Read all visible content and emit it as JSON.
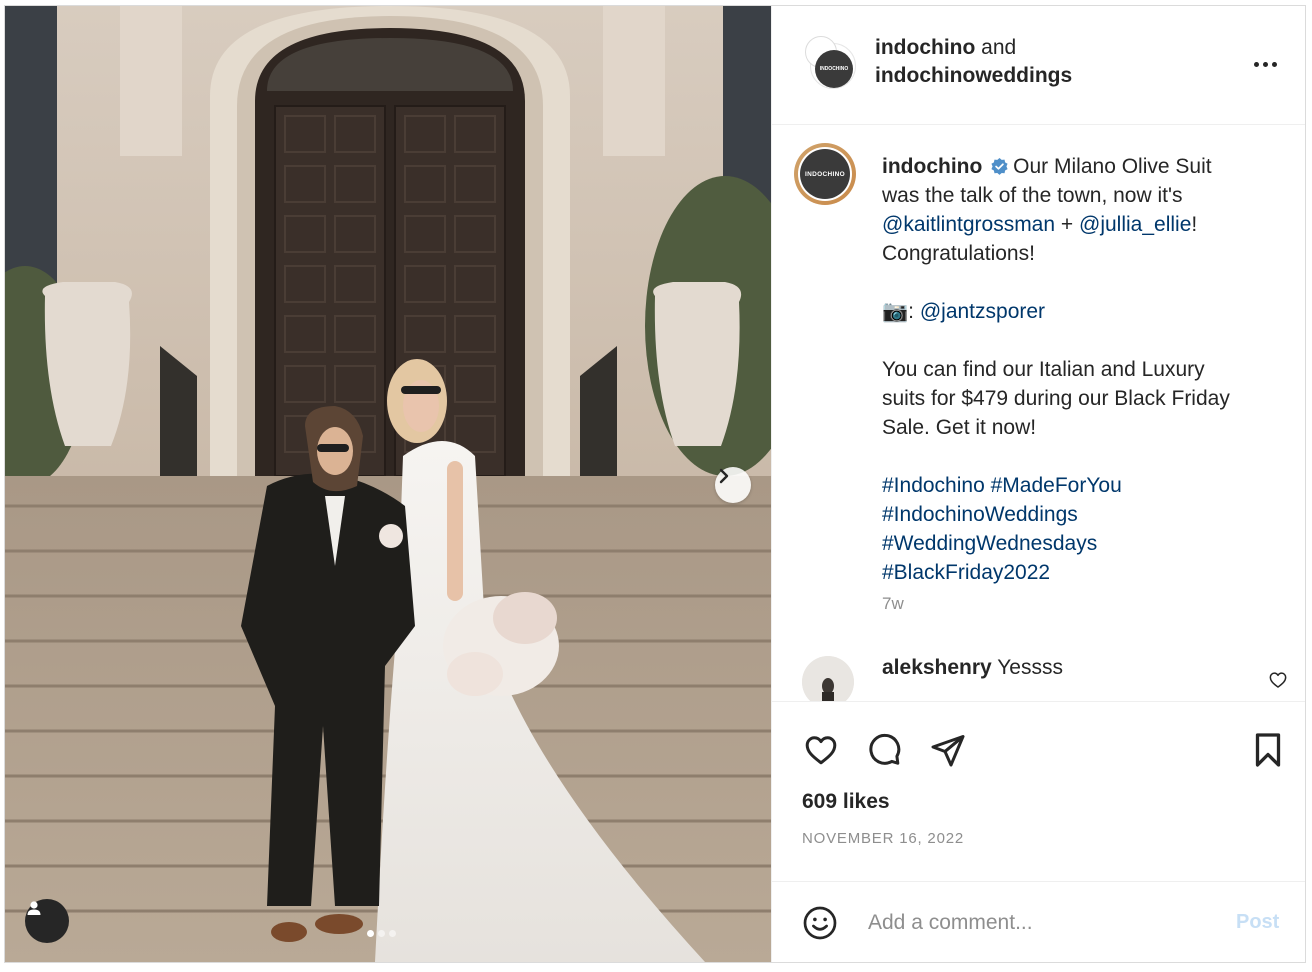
{
  "header": {
    "account_primary": "indochino",
    "joiner": "and",
    "account_secondary": "indochinoweddings",
    "avatar_text": "INDOCHINO"
  },
  "caption": {
    "username": "indochino",
    "line1": "Our Milano Olive Suit was the talk of the town, now it's",
    "mention1": "@kaitlintgrossman",
    "plus": "+",
    "mention2": "@jullia_ellie",
    "exclaim": "!",
    "congrats": "Congratulations!",
    "camera_emoji": "📷",
    "colon": ":",
    "photographer": "@jantzsporer",
    "sale_text": "You can find our Italian and Luxury suits for $479 during our Black Friday Sale. Get it now!",
    "hashtags": [
      "#Indochino",
      "#MadeForYou",
      "#IndochinoWeddings",
      "#WeddingWednesdays",
      "#BlackFriday2022"
    ],
    "time_ago": "7w"
  },
  "comment": {
    "username": "alekshenry",
    "text": "Yessss"
  },
  "actions": {
    "likes": "609 likes",
    "date": "NOVEMBER 16, 2022"
  },
  "add_comment": {
    "placeholder": "Add a comment...",
    "post_label": "Post"
  },
  "icons": {
    "like": "heart-icon",
    "comment": "comment-bubble-icon",
    "share": "paper-plane-icon",
    "save": "bookmark-icon",
    "emoji": "smiley-icon",
    "more": "ellipsis-icon",
    "next": "chevron-right-icon",
    "tags": "user-tag-icon"
  },
  "colors": {
    "link": "#00376b",
    "text": "#262626",
    "muted": "#8e8e8e",
    "post_disabled": "#c7dff5",
    "verified": "#4f8fc9"
  },
  "carousel": {
    "slide_count": 3,
    "active_index": 0
  }
}
